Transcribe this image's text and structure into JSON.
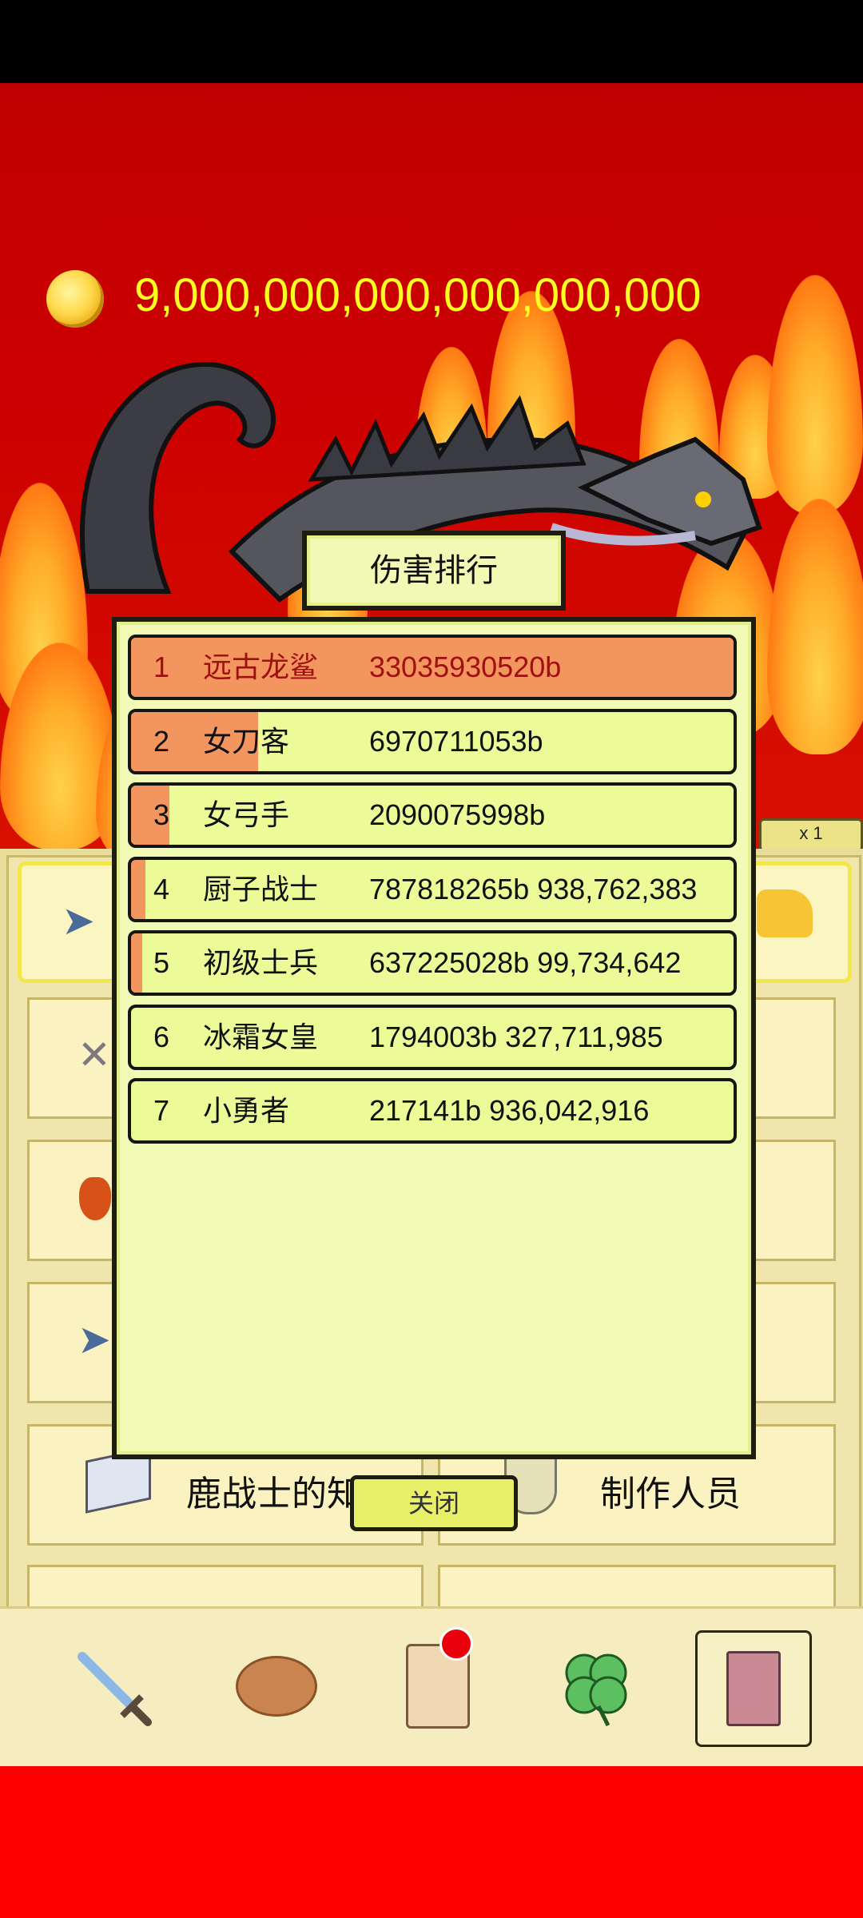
{
  "currency": {
    "amount": "9,000,000,000,000,000,000",
    "icon": "gold-coin-icon"
  },
  "speed_button": "x 1",
  "modal": {
    "title": "伤害排行",
    "rows": [
      {
        "rank": "1",
        "name": "远古龙鲨",
        "value": "33035930520b",
        "share": 1.0
      },
      {
        "rank": "2",
        "name": "女刀客",
        "value": "6970711053b",
        "share": 0.211
      },
      {
        "rank": "3",
        "name": "女弓手",
        "value": "2090075998b",
        "share": 0.063
      },
      {
        "rank": "4",
        "name": "厨子战士",
        "value": "787818265b 938,762,383",
        "share": 0.024
      },
      {
        "rank": "5",
        "name": "初级士兵",
        "value": "637225028b 99,734,642",
        "share": 0.019
      },
      {
        "rank": "6",
        "name": "冰霜女皇",
        "value": "1794003b 327,711,985",
        "share": 0.0
      },
      {
        "rank": "7",
        "name": "小勇者",
        "value": "217141b 936,042,916",
        "share": 0.0
      }
    ],
    "close_label": "关闭"
  },
  "menu": {
    "left_item": "鹿战士的知识",
    "right_item": "制作人员"
  },
  "nav": [
    {
      "icon": "sword-icon",
      "active": false
    },
    {
      "icon": "bread-icon",
      "active": false
    },
    {
      "icon": "scroll-icon",
      "active": false,
      "badge": true
    },
    {
      "icon": "clover-icon",
      "active": false
    },
    {
      "icon": "book-icon",
      "active": true
    }
  ],
  "colors": {
    "fill": "#f2955e",
    "row_bg": "#ecfb98",
    "gold": "#ffff20"
  }
}
